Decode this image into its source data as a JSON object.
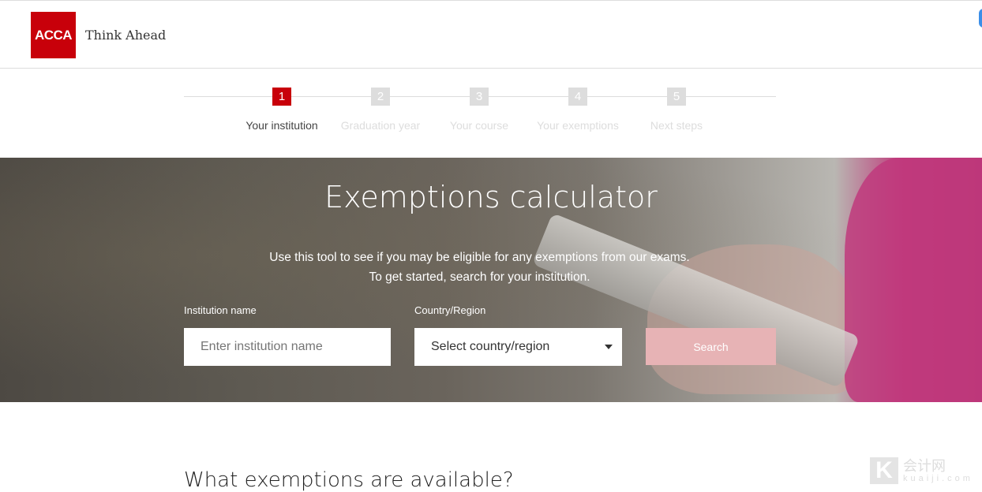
{
  "header": {
    "logo_text": "ACCA",
    "tagline": "Think Ahead"
  },
  "steps": [
    {
      "number": "1",
      "label": "Your institution",
      "active": true
    },
    {
      "number": "2",
      "label": "Graduation year",
      "active": false
    },
    {
      "number": "3",
      "label": "Your course",
      "active": false
    },
    {
      "number": "4",
      "label": "Your exemptions",
      "active": false
    },
    {
      "number": "5",
      "label": "Next steps",
      "active": false
    }
  ],
  "hero": {
    "title": "Exemptions calculator",
    "intro_line1": "Use this tool to see if you may be eligible for any exemptions from our exams.",
    "intro_line2": "To get started, search for your institution.",
    "institution_label": "Institution name",
    "institution_placeholder": "Enter institution name",
    "country_label": "Country/Region",
    "country_selected": "Select country/region",
    "search_label": "Search"
  },
  "section_heading": "What exemptions are available?",
  "watermark": {
    "cn": "会计网",
    "domain": "kuaiji.com"
  },
  "colors": {
    "brand": "#c8000a",
    "search_button": "#e7b3b5"
  }
}
